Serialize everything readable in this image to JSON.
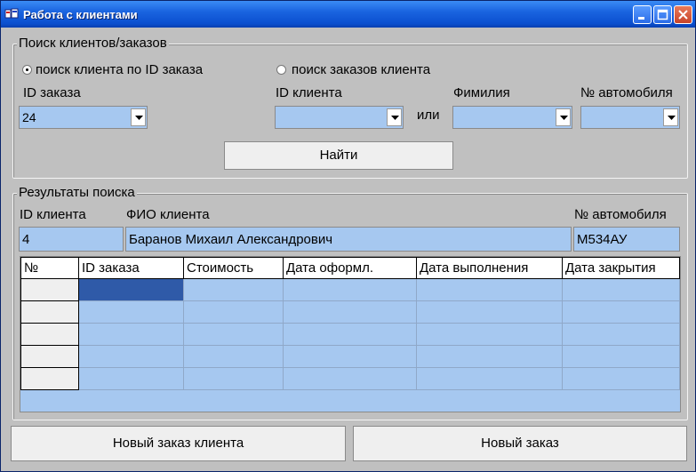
{
  "window": {
    "title": "Работа с клиентами"
  },
  "search": {
    "legend": "Поиск клиентов/заказов",
    "radio_by_order": "поиск клиента по ID заказа",
    "radio_client_orders": "поиск заказов клиента",
    "order_id_label": "ID заказа",
    "order_id_value": "24",
    "client_id_label": "ID клиента",
    "client_id_value": "",
    "or_label": "или",
    "surname_label": "Фимилия",
    "surname_value": "",
    "car_label": "№ автомобиля",
    "car_value": "",
    "find_button": "Найти"
  },
  "results": {
    "legend": "Результаты поиска",
    "client_id_label": "ID клиента",
    "client_id_value": "4",
    "fio_label": "ФИО клиента",
    "fio_value": "Баранов Михаил Александрович",
    "car_label": "№ автомобиля",
    "car_value": "М534АУ",
    "columns": [
      "№",
      "ID заказа",
      "Стоимость",
      "Дата оформл.",
      "Дата выполнения",
      "Дата закрытия"
    ]
  },
  "buttons": {
    "new_client_order": "Новый заказ  клиента",
    "new_order": "Новый заказ"
  },
  "colors": {
    "field_bg": "#a6c8f0",
    "selection": "#2f5aa8",
    "titlebar": "#0b4fcf"
  }
}
